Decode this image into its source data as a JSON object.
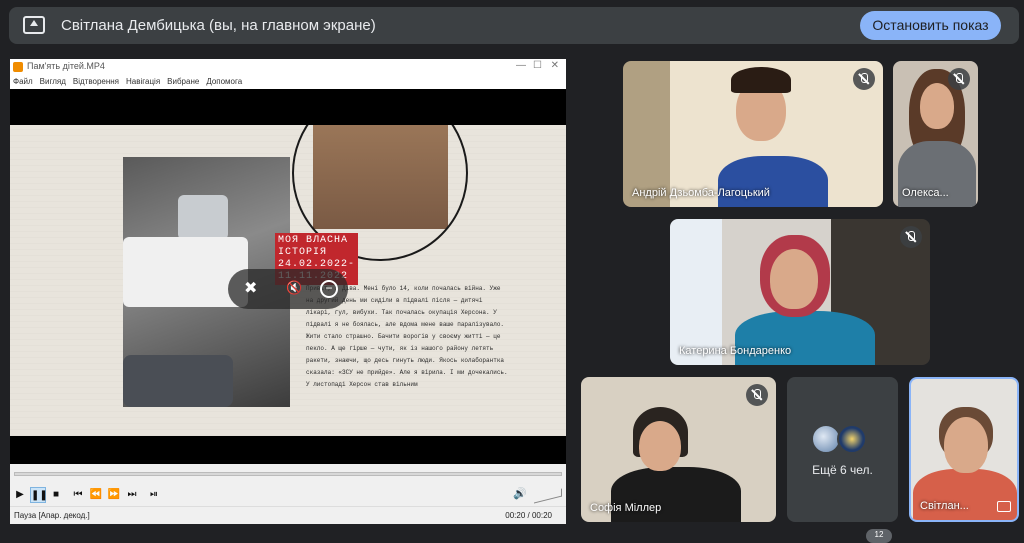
{
  "presentation": {
    "title": "Світлана Дембицька (вы, на главном экране)",
    "stop_label": "Остановить показ",
    "icon": "present-to-all-icon"
  },
  "player": {
    "window_title": "Пам'ять дітей.MP4",
    "menu": [
      "Файл",
      "Вигляд",
      "Відтворення",
      "Навігація",
      "Вибране",
      "Допомога"
    ],
    "video": {
      "label_lines": [
        "МОЯ ВЛАСНА",
        "ІСТОРІЯ",
        "24.02.2022-",
        "11.11.2022"
      ],
      "story_text": "Привіт, я Діва. Мені було 14, коли почалась війна. Уже на другий день ми сиділи в підвалі після — дитячі лікарі, гул, вибухи. Так почалась окупація Херсона. У підвалі я не боялась, але вдома мене ваше паралізувало. Жити стало страшно. Бачити ворогів у своєму житті — це пекло. А ще гірше — чути, як із нашого району летять ракети, знаючи, що десь гинуть люди. Якось колаборантка сказала: «ЗСУ не прийде». Але я вірила. І ми дочекались. У листопаді Херсон став вільним"
    },
    "status": "Пауза [Апар. декод.]",
    "time": "00:20 / 00:20",
    "progress": 1.0
  },
  "participants": [
    {
      "name": "Андрій Дзьомба-Лагоцький",
      "muted": true
    },
    {
      "name": "Олекса...",
      "muted": true
    },
    {
      "name": "Катерина Бондаренко",
      "muted": true
    },
    {
      "name": "Софія Міллер",
      "muted": true
    },
    {
      "name": "Світлан...",
      "muted": false
    }
  ],
  "others": {
    "label": "Ещё 6 чел."
  },
  "badge": "12",
  "colors": {
    "accent": "#8ab4f8",
    "background": "#202124",
    "tile": "#3c4043",
    "label_red": "#c1272d"
  }
}
